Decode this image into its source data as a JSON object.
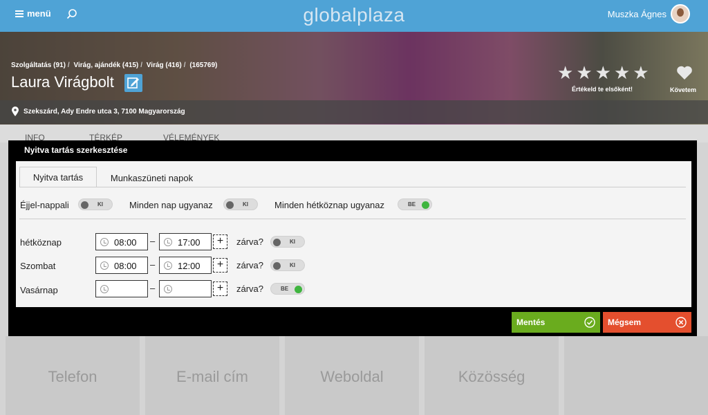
{
  "header": {
    "menu_label": "menü",
    "brand": "globalplaza",
    "user_name": "Muszka Ágnes"
  },
  "business": {
    "breadcrumb": [
      "Szolgáltatás (91)",
      "Virág, ajándék (415)",
      "Virág (416)",
      "(165769)"
    ],
    "name": "Laura Virágbolt",
    "rating_prompt": "Értékeld te elsőként!",
    "follow_label": "Követem",
    "address": "Szekszárd, Ady Endre utca 3, 7100 Magyarország",
    "rating_stars": 5
  },
  "background_tabs": [
    "INFO",
    "TÉRKÉP",
    "VÉLEMÉNYEK"
  ],
  "contact_tiles": [
    "Telefon",
    "E-mail cím",
    "Weboldal",
    "Közösség"
  ],
  "modal": {
    "title": "Nyitva tartás szerkesztése",
    "tabs": [
      {
        "label": "Nyitva tartás",
        "active": true
      },
      {
        "label": "Munkaszüneti napok",
        "active": false
      }
    ],
    "options": [
      {
        "label": "Éjjel-nappali",
        "toggle": "KI",
        "on": false
      },
      {
        "label": "Minden nap ugyanaz",
        "toggle": "KI",
        "on": false
      },
      {
        "label": "Minden hétköznap ugyanaz",
        "toggle": "BE",
        "on": true
      }
    ],
    "closed_label": "zárva?",
    "dash": "–",
    "plus": "+",
    "days": [
      {
        "label": "hétköznap",
        "from": "08:00",
        "to": "17:00",
        "closed_toggle": "KI",
        "closed": false
      },
      {
        "label": "Szombat",
        "from": "08:00",
        "to": "12:00",
        "closed_toggle": "KI",
        "closed": false
      },
      {
        "label": "Vasárnap",
        "from": "",
        "to": "",
        "closed_toggle": "BE",
        "closed": true
      }
    ],
    "save_label": "Mentés",
    "cancel_label": "Mégsem"
  },
  "colors": {
    "topbar": "#4fa3d6",
    "save": "#6aac1e",
    "cancel": "#e44f2e",
    "toggle_on": "#3fb53f"
  }
}
